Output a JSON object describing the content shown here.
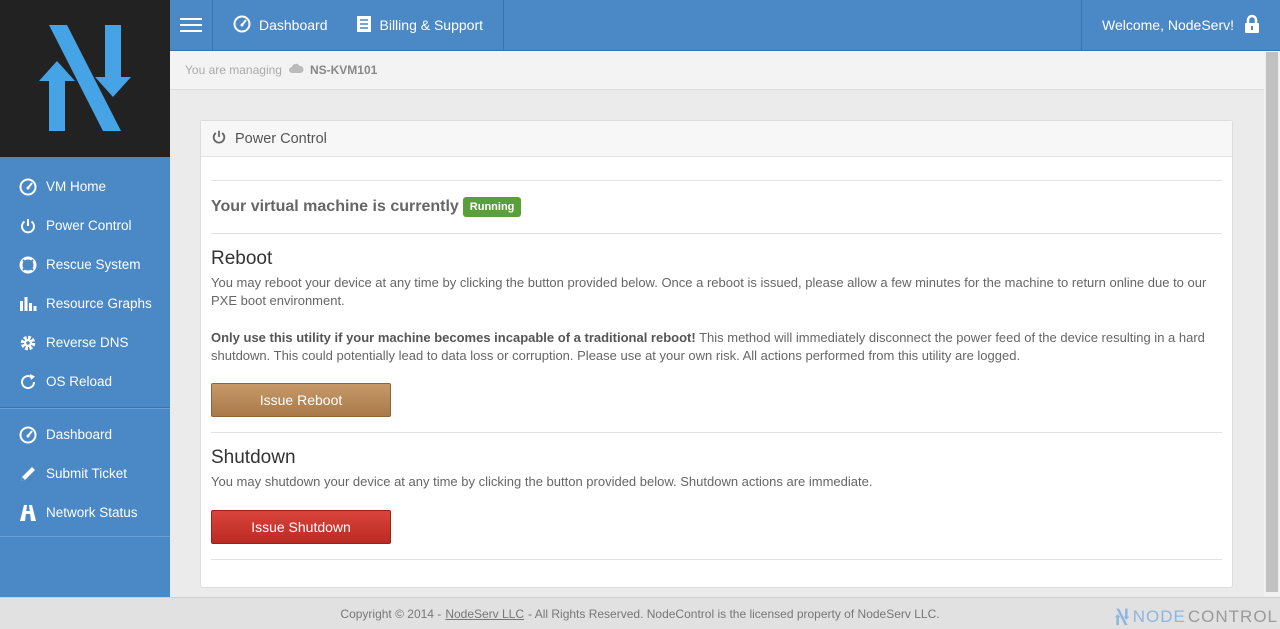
{
  "brand": {
    "accent": "#4a88c6",
    "logo_bg": "#222222",
    "logo_color": "#45a3e6"
  },
  "topbar": {
    "links": [
      {
        "label": "Dashboard",
        "icon": "dashboard-icon"
      },
      {
        "label": "Billing & Support",
        "icon": "billing-icon"
      }
    ],
    "welcome": "Welcome, NodeServ!"
  },
  "sidebar": {
    "vm_items": [
      {
        "label": "VM Home",
        "icon": "dashboard-icon"
      },
      {
        "label": "Power Control",
        "icon": "power-icon"
      },
      {
        "label": "Rescue System",
        "icon": "lifebuoy-icon"
      },
      {
        "label": "Resource Graphs",
        "icon": "bar-chart-icon"
      },
      {
        "label": "Reverse DNS",
        "icon": "gear-icon"
      },
      {
        "label": "OS Reload",
        "icon": "refresh-icon"
      }
    ],
    "account_items": [
      {
        "label": "Dashboard",
        "icon": "dashboard-icon"
      },
      {
        "label": "Submit Ticket",
        "icon": "pencil-icon"
      },
      {
        "label": "Network Status",
        "icon": "network-icon"
      }
    ]
  },
  "breadcrumb": {
    "prefix": "You are managing",
    "server": "NS-KVM101"
  },
  "panel": {
    "title": "Power Control",
    "status_text": "Your virtual machine is currently",
    "status_badge": "Running",
    "status_color": "#5aa03a",
    "reboot": {
      "heading": "Reboot",
      "text": "You may reboot your device at any time by clicking the button provided below. Once a reboot is issued, please allow a few minutes for the machine to return online due to our PXE boot environment.",
      "warning_bold": "Only use this utility if your machine becomes incapable of a traditional reboot!",
      "warning_text": " This method will immediately disconnect the power feed of the device resulting in a hard shutdown. This could potentially lead to data loss or corruption. Please use at your own risk. All actions performed from this utility are logged.",
      "button": "Issue Reboot"
    },
    "shutdown": {
      "heading": "Shutdown",
      "text": "You may shutdown your device at any time by clicking the button provided below. Shutdown actions are immediate.",
      "button": "Issue Shutdown"
    }
  },
  "footer": {
    "prefix": "Copyright © 2014 -",
    "company": "NodeServ LLC",
    "suffix": "- All Rights Reserved. NodeControl is the licensed property of NodeServ LLC.",
    "brand_1": "NODE",
    "brand_2": "CONTROL"
  }
}
